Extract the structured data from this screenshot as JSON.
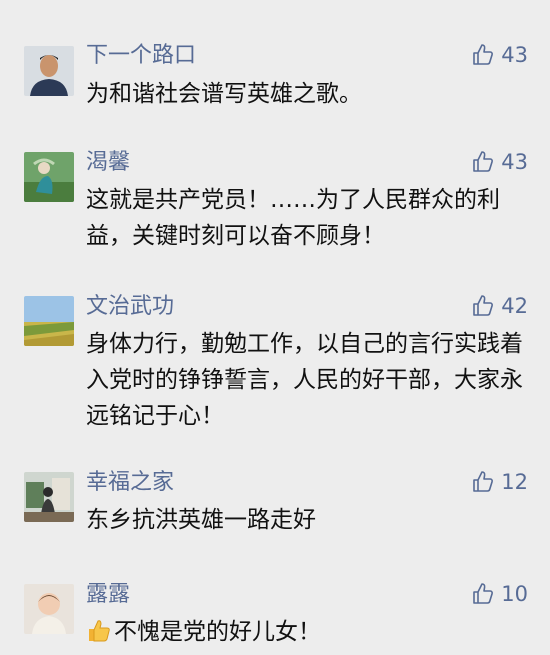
{
  "comments": [
    {
      "name": "下一个路口",
      "likes": "43",
      "text": "为和谐社会谱写英雄之歌。"
    },
    {
      "name": "渴馨",
      "likes": "43",
      "text": "这就是共产党员！……为了人民群众的利益，关键时刻可以奋不顾身！"
    },
    {
      "name": "文治武功",
      "likes": "42",
      "text": "身体力行，勤勉工作，以自己的言行实践着入党时的铮铮誓言，人民的好干部，大家永远铭记于心！"
    },
    {
      "name": "幸福之家",
      "likes": "12",
      "text": "东乡抗洪英雄一路走好"
    },
    {
      "name": "露露",
      "likes": "10",
      "text": "不愧是党的好儿女！"
    }
  ],
  "icons": {
    "like": "thumbs-up-outline-icon",
    "emoji": "thumbs-up-emoji"
  },
  "colors": {
    "name": "#576b95",
    "text": "#111111",
    "background": "#ededed"
  }
}
